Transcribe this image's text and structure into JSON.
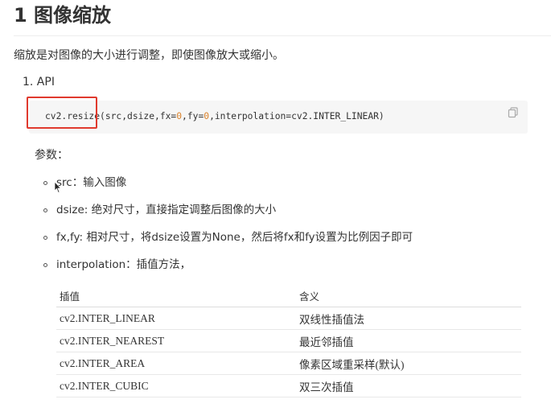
{
  "title": "1 图像缩放",
  "intro": "缩放是对图像的大小进行调整，即使图像放大或缩小。",
  "list_item": "1. API",
  "code": {
    "prefix": "cv2.resize(src,dsize,fx=",
    "fx_value": "0",
    "middle": ",fy=",
    "fy_value": "0",
    "suffix": ",interpolation=cv2.INTER_LINEAR)",
    "number_color": "#d9822b"
  },
  "highlight_color": "#e03a2e",
  "params_label": "参数：",
  "params": [
    "src：输入图像",
    "dsize: 绝对尺寸，直接指定调整后图像的大小",
    "fx,fy: 相对尺寸，将dsize设置为None，然后将fx和fy设置为比例因子即可",
    "interpolation：插值方法，"
  ],
  "table": {
    "headers": [
      "插值",
      "含义"
    ],
    "rows": [
      [
        "cv2.INTER_LINEAR",
        "双线性插值法"
      ],
      [
        "cv2.INTER_NEAREST",
        "最近邻插值"
      ],
      [
        "cv2.INTER_AREA",
        "像素区域重采样(默认)"
      ],
      [
        "cv2.INTER_CUBIC",
        "双三次插值"
      ]
    ]
  },
  "icons": {
    "copy": "copy-icon",
    "cursor": "cursor-icon"
  }
}
